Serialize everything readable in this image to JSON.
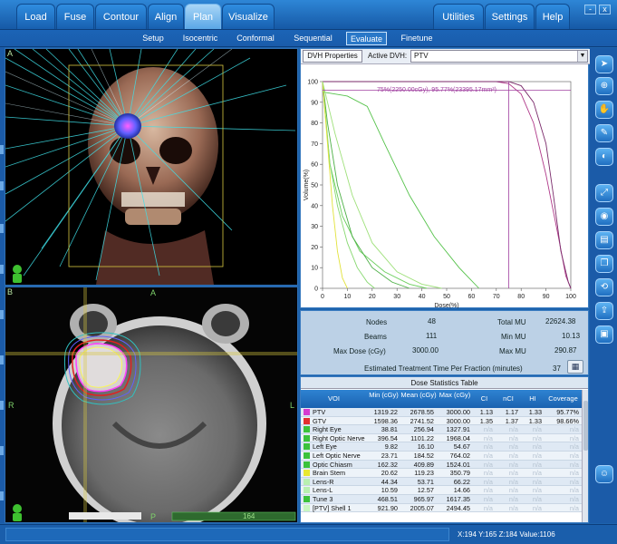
{
  "tabs": [
    {
      "label": "Load"
    },
    {
      "label": "Fuse"
    },
    {
      "label": "Contour"
    },
    {
      "label": "Align"
    },
    {
      "label": "Plan"
    },
    {
      "label": "Visualize"
    },
    {
      "label": "Utilities"
    },
    {
      "label": "Settings"
    },
    {
      "label": "Help"
    }
  ],
  "active_tab": "Plan",
  "window_buttons": {
    "minimize": "-",
    "close": "x"
  },
  "subtabs": [
    {
      "label": "Setup"
    },
    {
      "label": "Isocentric"
    },
    {
      "label": "Conformal"
    },
    {
      "label": "Sequential"
    },
    {
      "label": "Evaluate"
    },
    {
      "label": "Finetune"
    }
  ],
  "active_subtab": "Evaluate",
  "viewA": {
    "label": "A"
  },
  "viewB": {
    "label": "B",
    "orientation_top": "A",
    "orientation_left": "R",
    "orientation_right": "L",
    "orientation_bottom": "P",
    "slice": "164"
  },
  "dvh": {
    "properties_button": "DVH Properties",
    "active_label": "Active DVH:",
    "active_value": "PTV",
    "annotation": "75%(2250.00cGy), 95.77%(23395.17mm³)",
    "xlabel": "Dose(%)",
    "ylabel": "Volume(%)"
  },
  "chart_data": {
    "type": "line",
    "xlabel": "Dose(%)",
    "ylabel": "Volume(%)",
    "xlim": [
      0,
      100
    ],
    "ylim": [
      0,
      100
    ],
    "xticks": [
      "0",
      "10",
      "20",
      "30",
      "40",
      "50",
      "60",
      "70",
      "80",
      "90",
      "100"
    ],
    "yticks": [
      "0",
      "10",
      "20",
      "30",
      "40",
      "50",
      "60",
      "70",
      "80",
      "90",
      "100"
    ],
    "series": [
      {
        "color": "#b03a8a",
        "x": [
          0,
          70,
          75,
          80,
          85,
          90,
          95,
          98,
          100
        ],
        "y": [
          100,
          100,
          99,
          94,
          80,
          55,
          25,
          6,
          0
        ]
      },
      {
        "color": "#7a2a6a",
        "x": [
          0,
          75,
          80,
          85,
          90,
          93,
          96,
          99,
          100
        ],
        "y": [
          100,
          100,
          98,
          90,
          70,
          45,
          18,
          3,
          0
        ]
      },
      {
        "color": "#55c24a",
        "x": [
          0,
          10,
          18,
          25,
          35,
          45,
          55,
          63
        ],
        "y": [
          95,
          93,
          88,
          70,
          45,
          25,
          10,
          0
        ]
      },
      {
        "color": "#6bcf5d",
        "x": [
          0,
          3,
          8,
          15,
          25,
          35,
          42
        ],
        "y": [
          100,
          60,
          35,
          18,
          8,
          2,
          0
        ]
      },
      {
        "color": "#4caf45",
        "x": [
          0,
          2,
          6,
          12,
          20,
          28,
          35
        ],
        "y": [
          100,
          80,
          50,
          25,
          10,
          3,
          0
        ]
      },
      {
        "color": "#86d86f",
        "x": [
          0,
          1,
          3,
          6,
          10,
          14,
          18,
          21
        ],
        "y": [
          100,
          85,
          60,
          40,
          22,
          10,
          3,
          0
        ]
      },
      {
        "color": "#e2e23a",
        "x": [
          0,
          2,
          4,
          6,
          8,
          10
        ],
        "y": [
          100,
          70,
          40,
          18,
          5,
          0
        ]
      },
      {
        "color": "#9ee07a",
        "x": [
          0,
          5,
          12,
          20,
          30,
          40,
          48
        ],
        "y": [
          100,
          75,
          45,
          22,
          8,
          2,
          0
        ]
      }
    ],
    "vline_x": 75,
    "hline_y": 95.77
  },
  "stats": {
    "nodes_label": "Nodes",
    "nodes": "48",
    "beams_label": "Beams",
    "beams": "111",
    "maxdose_label": "Max Dose (cGy)",
    "maxdose": "3000.00",
    "totalmu_label": "Total MU",
    "totalmu": "22624.38",
    "minmu_label": "Min MU",
    "minmu": "10.13",
    "maxmu_label": "Max MU",
    "maxmu": "290.87",
    "est_label": "Estimated Treatment Time Per Fraction (minutes)",
    "est": "37"
  },
  "table": {
    "title": "Dose Statistics Table",
    "headers": {
      "voi": "VOI",
      "min": "Min (cGy)",
      "mean": "Mean (cGy)",
      "max": "Max (cGy)",
      "ci": "CI",
      "nci": "nCI",
      "hi": "HI",
      "cov": "Coverage"
    },
    "rows": [
      {
        "color": "#d63bd0",
        "voi": "PTV",
        "min": "1319.22",
        "mean": "2678.55",
        "max": "3000.00",
        "ci": "1.13",
        "nci": "1.17",
        "hi": "1.33",
        "cov": "95.77%"
      },
      {
        "color": "#e23030",
        "voi": "GTV",
        "min": "1598.36",
        "mean": "2741.52",
        "max": "3000.00",
        "ci": "1.35",
        "nci": "1.37",
        "hi": "1.33",
        "cov": "98.66%"
      },
      {
        "color": "#3bc23b",
        "voi": "Right Eye",
        "min": "38.81",
        "mean": "256.94",
        "max": "1327.91",
        "ci": "n/a",
        "nci": "n/a",
        "hi": "n/a",
        "cov": "n/a"
      },
      {
        "color": "#3bc23b",
        "voi": "Right Optic Nerve",
        "min": "396.54",
        "mean": "1101.22",
        "max": "1968.04",
        "ci": "n/a",
        "nci": "n/a",
        "hi": "n/a",
        "cov": "n/a"
      },
      {
        "color": "#3bc23b",
        "voi": "Left Eye",
        "min": "9.82",
        "mean": "16.10",
        "max": "54.67",
        "ci": "n/a",
        "nci": "n/a",
        "hi": "n/a",
        "cov": "n/a"
      },
      {
        "color": "#3bc23b",
        "voi": "Left Optic Nerve",
        "min": "23.71",
        "mean": "184.52",
        "max": "764.02",
        "ci": "n/a",
        "nci": "n/a",
        "hi": "n/a",
        "cov": "n/a"
      },
      {
        "color": "#3bc23b",
        "voi": "Optic Chiasm",
        "min": "162.32",
        "mean": "409.89",
        "max": "1524.01",
        "ci": "n/a",
        "nci": "n/a",
        "hi": "n/a",
        "cov": "n/a"
      },
      {
        "color": "#e8e830",
        "voi": "Brain Stem",
        "min": "20.62",
        "mean": "119.23",
        "max": "350.79",
        "ci": "n/a",
        "nci": "n/a",
        "hi": "n/a",
        "cov": "n/a"
      },
      {
        "color": "#b8f0b0",
        "voi": "Lens-R",
        "min": "44.34",
        "mean": "53.71",
        "max": "66.22",
        "ci": "n/a",
        "nci": "n/a",
        "hi": "n/a",
        "cov": "n/a"
      },
      {
        "color": "#b8f0b0",
        "voi": "Lens-L",
        "min": "10.59",
        "mean": "12.57",
        "max": "14.66",
        "ci": "n/a",
        "nci": "n/a",
        "hi": "n/a",
        "cov": "n/a"
      },
      {
        "color": "#3bc23b",
        "voi": "Tune 3",
        "min": "468.51",
        "mean": "965.97",
        "max": "1617.35",
        "ci": "n/a",
        "nci": "n/a",
        "hi": "n/a",
        "cov": "n/a"
      },
      {
        "color": "#c8f7c0",
        "voi": "[PTV] Shell 1",
        "min": "921.90",
        "mean": "2005.07",
        "max": "2494.45",
        "ci": "n/a",
        "nci": "n/a",
        "hi": "n/a",
        "cov": "n/a"
      }
    ]
  },
  "status": {
    "coords": "X:194 Y:165 Z:184  Value:1106"
  },
  "tools": [
    "pointer-icon",
    "zoom-icon",
    "pan-hand-icon",
    "ruler-icon",
    "window-level-icon",
    "fullscreen-icon",
    "camera-icon",
    "print-icon",
    "copy-icon",
    "reset-icon",
    "export-icon",
    "save-icon",
    "help-person-icon"
  ]
}
